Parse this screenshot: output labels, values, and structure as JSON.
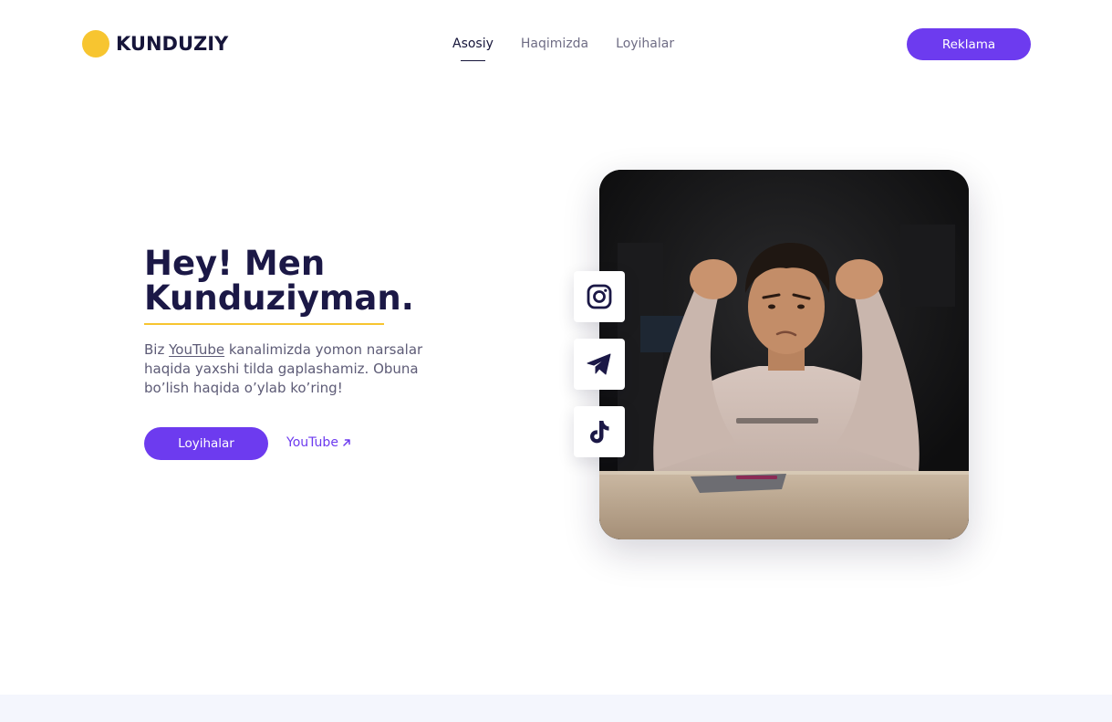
{
  "header": {
    "logo_text": "KUNDUZIY",
    "nav": [
      "Asosiy",
      "Haqimizda",
      "Loyihalar"
    ],
    "active_nav": "Asosiy",
    "cta_label": "Reklama"
  },
  "hero": {
    "title_line1": "Hey! Men",
    "title_line2": "Kunduziyman.",
    "desc_before": "Biz ",
    "desc_link": "YouTube",
    "desc_after": " kanalimizda yomon narsalar haqida yaxshi tilda gaplashamiz. Obuna bo’lish haqida o’ylab ko’ring!",
    "primary_button": "Loyihalar",
    "secondary_link": "YouTube"
  },
  "social": [
    "instagram-icon",
    "telegram-icon",
    "tiktok-icon"
  ],
  "colors": {
    "accent": "#6d3bef",
    "logo_dot": "#f7c530",
    "heading": "#1b1846",
    "footer_band": "#f4f6fd"
  }
}
